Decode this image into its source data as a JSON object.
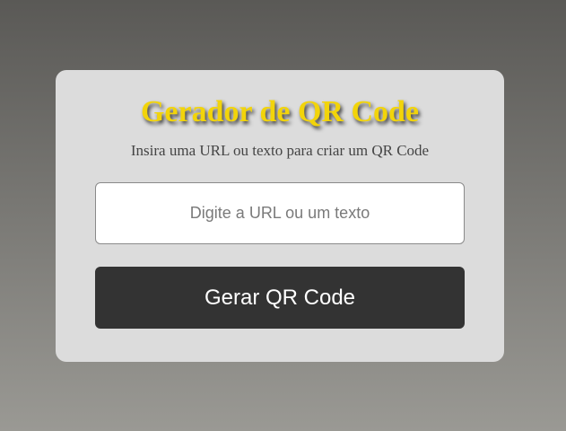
{
  "card": {
    "title": "Gerador de QR Code",
    "subtitle": "Insira uma URL ou texto para criar um QR Code",
    "input": {
      "placeholder": "Digite a URL ou um texto",
      "value": ""
    },
    "button_label": "Gerar QR Code"
  },
  "colors": {
    "title": "#f2d40a",
    "card_background": "#dcdcdc",
    "button_background": "#333333",
    "button_text": "#ffffff"
  }
}
